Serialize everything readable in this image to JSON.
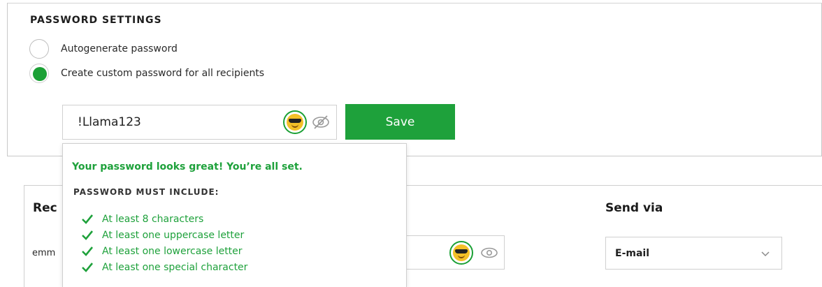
{
  "password_settings": {
    "title": "PASSWORD SETTINGS",
    "options": [
      {
        "label": "Autogenerate password",
        "selected": false
      },
      {
        "label": "Create custom password for all recipients",
        "selected": true
      }
    ],
    "password_value": "!Llama123",
    "strength_icon": "sunglasses-emoji-icon",
    "visibility_icon": "eye-slash-icon",
    "save_label": "Save"
  },
  "strength_popover": {
    "status": "Your password looks great! You’re all set.",
    "requirements_title": "PASSWORD MUST INCLUDE:",
    "requirements": [
      {
        "text": "At least 8 characters",
        "met": true
      },
      {
        "text": "At least one uppercase letter",
        "met": true
      },
      {
        "text": "At least one lowercase letter",
        "met": true
      },
      {
        "text": "At least one special character",
        "met": true
      }
    ]
  },
  "recipients": {
    "column_header_partial": "Rec",
    "row_email_partial": "emm",
    "strength_icon": "sunglasses-emoji-icon",
    "visibility_icon": "eye-icon"
  },
  "send_via": {
    "header": "Send via",
    "selected": "E-mail"
  },
  "colors": {
    "accent_green": "#1ea13b",
    "border": "#d0d0d0",
    "emoji_yellow": "#f4c028"
  }
}
